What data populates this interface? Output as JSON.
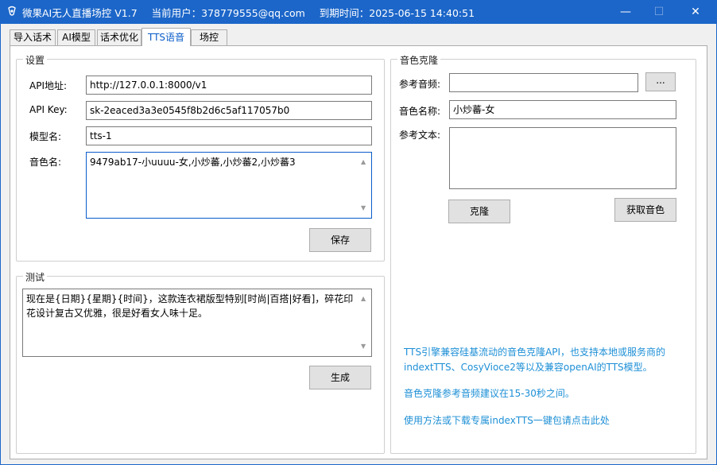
{
  "titlebar": {
    "app_name": "微果AI无人直播场控 V1.7",
    "user": "当前用户：378779555@qq.com",
    "expire": "到期时间：2025-06-15 14:40:51",
    "minimize": "—",
    "maximize": "☐",
    "close": "✕"
  },
  "tabs": [
    "导入话术",
    "AI模型",
    "话术优化",
    "TTS语音",
    "场控"
  ],
  "settings": {
    "group_title": "设置",
    "api_url_label": "API地址:",
    "api_url_value": "http://127.0.0.1:8000/v1",
    "api_key_label": "API Key:",
    "api_key_value": "sk-2eaced3a3e0545f8b2d6c5af117057b0",
    "model_label": "模型名:",
    "model_value": "tts-1",
    "voice_label": "音色名:",
    "voice_value": "9479ab17-小uuuu-女,小炒蕃,小炒蕃2,小炒蕃3",
    "save_button": "保存"
  },
  "test": {
    "group_title": "测试",
    "text": "现在是{日期}{星期}{时间}，这款连衣裙版型特别[时尚|百搭|好看]，碎花印花设计复古又优雅，很是好看女人味十足。",
    "generate_button": "生成"
  },
  "clone": {
    "group_title": "音色克隆",
    "ref_audio_label": "参考音频:",
    "ref_audio_value": "",
    "browse_button": "...",
    "voice_name_label": "音色名称:",
    "voice_name_value": "小炒蕃-女",
    "ref_text_label": "参考文本:",
    "ref_text_value": "",
    "clone_button": "克隆",
    "fetch_button": "获取音色"
  },
  "info": {
    "line1": "TTS引擎兼容硅基流动的音色克隆API，也支持本地或服务商的",
    "line2": "indextTTS、CosyVioce2等以及兼容openAI的TTS模型。",
    "line3": "音色克隆参考音频建议在15-30秒之间。",
    "line4": "使用方法或下载专属indexTTS一键包请点击此处"
  },
  "colors": {
    "titlebar": "#1c66c9",
    "active_tab": "#0a5cc9",
    "info_text": "#1d8fd6"
  }
}
